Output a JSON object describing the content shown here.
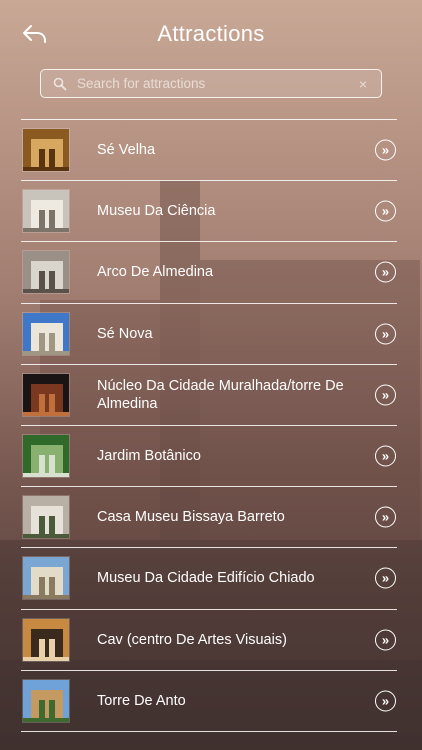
{
  "header": {
    "title": "Attractions",
    "back_icon": "back-arrow-icon"
  },
  "search": {
    "placeholder": "Search for attractions",
    "value": "",
    "clear_glyph": "×"
  },
  "items": [
    {
      "label": "Sé Velha",
      "thumb_colors": [
        "#8a5a20",
        "#d8a860",
        "#5a3410"
      ]
    },
    {
      "label": "Museu Da Ciência",
      "thumb_colors": [
        "#c9c4bb",
        "#eeeae2",
        "#7c7468"
      ]
    },
    {
      "label": "Arco De Almedina",
      "thumb_colors": [
        "#9a9088",
        "#d9d4cc",
        "#5a524a"
      ]
    },
    {
      "label": "Sé Nova",
      "thumb_colors": [
        "#3f78c8",
        "#ece6da",
        "#a09684"
      ]
    },
    {
      "label": "Núcleo Da Cidade Muralhada/torre De Almedina",
      "thumb_colors": [
        "#1a1414",
        "#7a3820",
        "#c0703a"
      ]
    },
    {
      "label": "Jardim Botânico",
      "thumb_colors": [
        "#2f6a2a",
        "#8ab070",
        "#d8e0d0"
      ]
    },
    {
      "label": "Casa Museu Bissaya Barreto",
      "thumb_colors": [
        "#b8b0a4",
        "#e6e2da",
        "#4a5a3a"
      ]
    },
    {
      "label": "Museu Da Cidade Edifício Chiado",
      "thumb_colors": [
        "#7aa6d4",
        "#e2dbc8",
        "#8a7a60"
      ]
    },
    {
      "label": "Cav (centro De Artes Visuais)",
      "thumb_colors": [
        "#c88a40",
        "#3a2a1e",
        "#e8d0a8"
      ]
    },
    {
      "label": "Torre De Anto",
      "thumb_colors": [
        "#6fa2d8",
        "#c49a60",
        "#3e6a30"
      ]
    }
  ],
  "row_action_glyph": "»"
}
